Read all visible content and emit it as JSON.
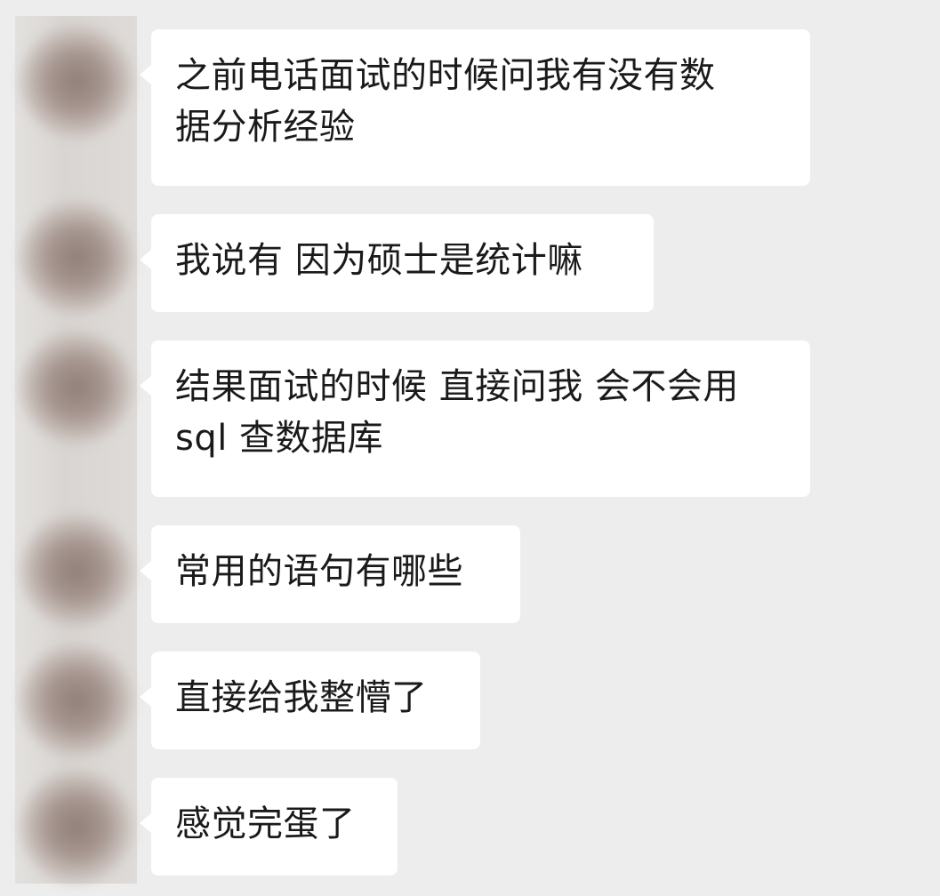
{
  "colors": {
    "background": "#ededed",
    "bubble": "#ffffff",
    "text": "#1a1a1a"
  },
  "messages": [
    {
      "text": "之前电话面试的时候问我有没有数\n据分析经验",
      "avatar_icon": "blurred-avatar"
    },
    {
      "text": "我说有 因为硕士是统计嘛",
      "avatar_icon": "blurred-avatar"
    },
    {
      "text": "结果面试的时候 直接问我 会不会用\nsql 查数据库",
      "avatar_icon": "blurred-avatar"
    },
    {
      "text": "常用的语句有哪些",
      "avatar_icon": "blurred-avatar"
    },
    {
      "text": "直接给我整懵了",
      "avatar_icon": "blurred-avatar"
    },
    {
      "text": "感觉完蛋了",
      "avatar_icon": "blurred-avatar"
    }
  ]
}
